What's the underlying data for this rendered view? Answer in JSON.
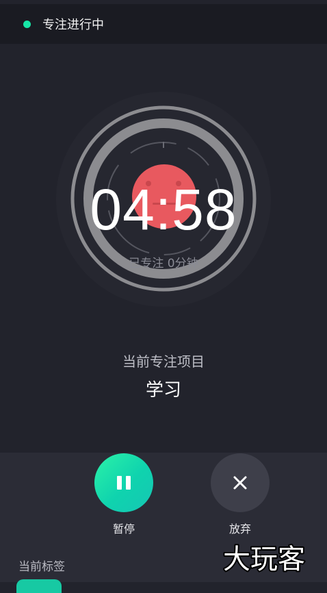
{
  "status": {
    "text": "专注进行中",
    "dot_color": "#17e6a6"
  },
  "timer": {
    "display": "04:58",
    "focused_text": "已专注 0分钟"
  },
  "project": {
    "label": "当前专注项目",
    "name": "学习"
  },
  "controls": {
    "pause_label": "暂停",
    "quit_label": "放弃",
    "accent": "#17e6a6"
  },
  "tags": {
    "title": "当前标签"
  },
  "watermark": {
    "text": "大玩客"
  },
  "colors": {
    "background": "#22232c",
    "face": "#e8595f",
    "ring": "#8c8c90"
  }
}
